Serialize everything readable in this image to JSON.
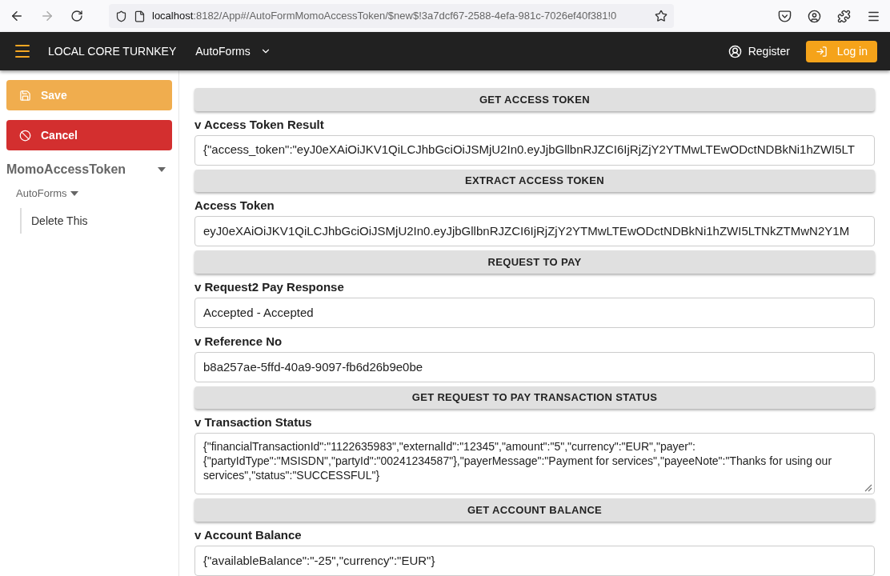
{
  "browser": {
    "url_host": "localhost",
    "url_rest": ":8182/App#/AutoFormMomoAccessToken/$new$!3a7dcf67-2588-4efa-981c-7026ef40f381!0"
  },
  "navbar": {
    "title": "LOCAL CORE TURNKEY",
    "menu": "AutoForms",
    "register": "Register",
    "login": "Log in"
  },
  "sidebar": {
    "save": "Save",
    "cancel": "Cancel",
    "tree": {
      "label": "MomoAccessToken",
      "expanded": true,
      "children": [
        {
          "label": "AutoForms",
          "expanded": true,
          "children": [
            {
              "label": "Delete This"
            }
          ]
        }
      ]
    }
  },
  "form": [
    {
      "kind": "button",
      "label": "GET ACCESS TOKEN"
    },
    {
      "kind": "field",
      "label": "v Access Token Result",
      "value": "{\"access_token\":\"eyJ0eXAiOiJKV1QiLCJhbGciOiJSMjU2In0.eyJjbGllbnRJZCI6IjRjZjY2YTMwLTEwODctNDBkNi1hZWI5LT"
    },
    {
      "kind": "button",
      "label": "EXTRACT ACCESS TOKEN"
    },
    {
      "kind": "field",
      "label": "Access Token",
      "value": "eyJ0eXAiOiJKV1QiLCJhbGciOiJSMjU2In0.eyJjbGllbnRJZCI6IjRjZjY2YTMwLTEwODctNDBkNi1hZWI5LTNkZTMwN2Y1M"
    },
    {
      "kind": "button",
      "label": "REQUEST TO PAY"
    },
    {
      "kind": "field",
      "label": "v Request2 Pay Response",
      "value": "Accepted - Accepted"
    },
    {
      "kind": "field",
      "label": "v Reference No",
      "value": "b8a257ae-5ffd-40a9-9097-fb6d26b9e0be"
    },
    {
      "kind": "button",
      "label": "GET REQUEST TO PAY TRANSACTION STATUS"
    },
    {
      "kind": "textarea",
      "label": "v Transaction Status",
      "value": "{\"financialTransactionId\":\"1122635983\",\"externalId\":\"12345\",\"amount\":\"5\",\"currency\":\"EUR\",\"payer\":{\"partyIdType\":\"MSISDN\",\"partyId\":\"00241234587\"},\"payerMessage\":\"Payment for services\",\"payeeNote\":\"Thanks for using our services\",\"status\":\"SUCCESSFUL\"}"
    },
    {
      "kind": "button",
      "label": "GET ACCOUNT BALANCE"
    },
    {
      "kind": "field",
      "label": "v Account Balance",
      "value": "{\"availableBalance\":\"-25\",\"currency\":\"EUR\"}"
    }
  ]
}
